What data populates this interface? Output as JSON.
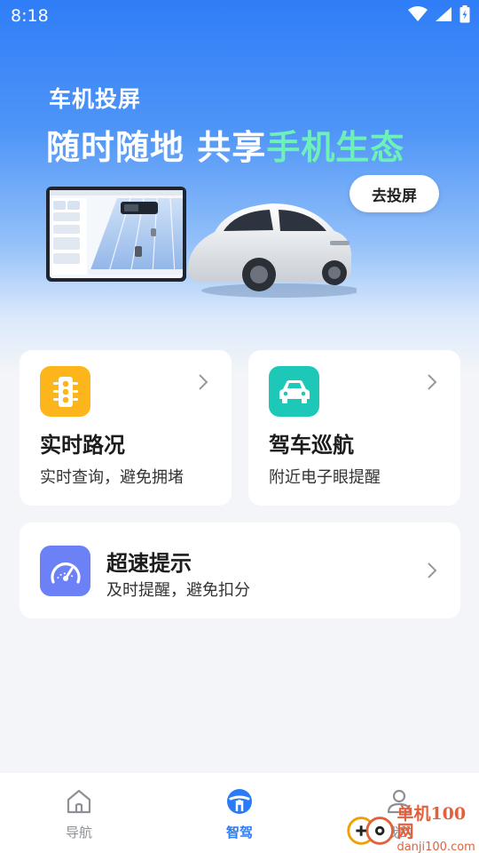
{
  "status_bar": {
    "time": "8:18"
  },
  "hero": {
    "subtitle": "车机投屏",
    "title_main": "随时随地 共享",
    "title_highlight": "手机生态",
    "cast_button": "去投屏"
  },
  "cards": [
    {
      "title": "实时路况",
      "desc": "实时查询，避免拥堵",
      "icon": "traffic-light-icon",
      "color": "#fcb51a"
    },
    {
      "title": "驾车巡航",
      "desc": "附近电子眼提醒",
      "icon": "car-icon",
      "color": "#1ec8b8"
    },
    {
      "title": "超速提示",
      "desc": "及时提醒，避免扣分",
      "icon": "speedometer-icon",
      "color": "#6d81f6"
    }
  ],
  "tabs": [
    {
      "label": "导航",
      "icon": "home-icon",
      "active": false
    },
    {
      "label": "智驾",
      "icon": "steering-wheel-icon",
      "active": true
    },
    {
      "label": "我的",
      "icon": "profile-icon",
      "active": false
    }
  ],
  "watermark": {
    "main": "单机100网",
    "sub": "danji100.com"
  },
  "colors": {
    "accent": "#2a7cf6",
    "highlight": "#6ef0b9"
  }
}
